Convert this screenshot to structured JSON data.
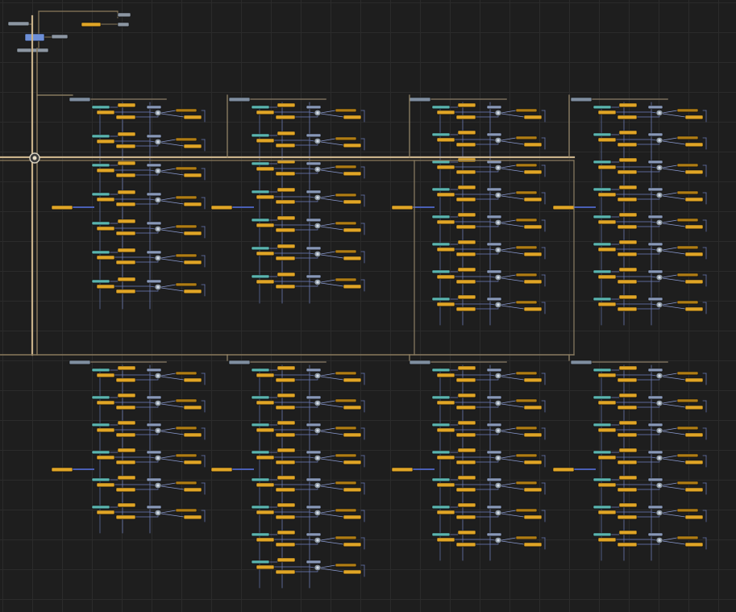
{
  "app": {
    "view": "node-graph"
  },
  "colors": {
    "background": "#1e1e1e",
    "grid": "#2b2b2b",
    "trunk_wire": "#c9b28a",
    "trunk_wire_dark": "#8a7a5c",
    "branch_wire": "#9a8a6c",
    "blue_wire": "#4a5fb5",
    "node_orange": "#e0a526",
    "node_orange_dark": "#b07d14",
    "node_grey": "#8e9aa8",
    "node_blue": "#5d7fb8",
    "node_teal": "#5ab5b0",
    "node_dark": "#2c2c2c",
    "selected_node": "#6d8fd8",
    "module_header": "#7f8ea0"
  },
  "icons": {
    "hub": "hub-dot-icon",
    "merge": "merge-node-icon"
  }
}
